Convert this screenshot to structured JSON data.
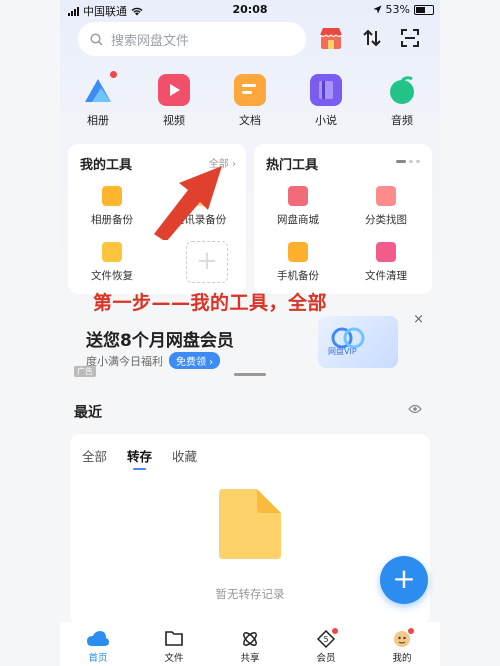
{
  "status": {
    "carrier": "中国联通",
    "time": "20:08",
    "battery": "53%"
  },
  "search": {
    "placeholder": "搜索网盘文件"
  },
  "quick": [
    {
      "label": "相册",
      "icon": "album-icon"
    },
    {
      "label": "视频",
      "icon": "video-icon"
    },
    {
      "label": "文档",
      "icon": "document-icon"
    },
    {
      "label": "小说",
      "icon": "novel-icon"
    },
    {
      "label": "音频",
      "icon": "audio-icon"
    }
  ],
  "my_tools": {
    "title": "我的工具",
    "more": "全部",
    "items": [
      {
        "label": "相册备份",
        "icon": "album-backup-icon"
      },
      {
        "label": "通讯录备份",
        "icon": "contacts-backup-icon"
      },
      {
        "label": "文件恢复",
        "icon": "file-restore-icon"
      }
    ]
  },
  "hot_tools": {
    "title": "热门工具",
    "items": [
      {
        "label": "网盘商城",
        "icon": "store-icon"
      },
      {
        "label": "分类找图",
        "icon": "image-search-icon"
      },
      {
        "label": "手机备份",
        "icon": "phone-backup-icon"
      },
      {
        "label": "文件清理",
        "icon": "file-clean-icon"
      }
    ]
  },
  "annotation": "第一步——我的工具，全部",
  "ad": {
    "title": "送您8个月网盘会员",
    "subtitle": "度小满今日福利",
    "button": "免费领",
    "tag": "广告",
    "card_label": "网盘VIP",
    "close": "×"
  },
  "recent": {
    "title": "最近",
    "tabs": [
      "全部",
      "转存",
      "收藏"
    ],
    "active_tab": "转存",
    "empty": "暂无转存记录"
  },
  "fab": "+",
  "tabbar": [
    {
      "label": "首页",
      "active": true
    },
    {
      "label": "文件"
    },
    {
      "label": "共享"
    },
    {
      "label": "会员"
    },
    {
      "label": "我的"
    }
  ],
  "colors": {
    "accent": "#2d8cf0",
    "annotation": "#d93425"
  }
}
